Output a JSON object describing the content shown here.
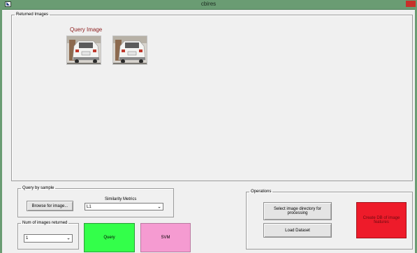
{
  "window": {
    "title": "cbires",
    "app_icon": "matlab-figure-icon",
    "close_color": "#c8302a"
  },
  "returned_images": {
    "legend": "Returned Images",
    "query_label": "Query Image",
    "thumbnails": [
      "car-photo-thumbnail",
      "car-photo-thumbnail"
    ]
  },
  "query_by_sample": {
    "legend": "Query by sample",
    "browse_label": "Browse for image...",
    "metrics_label": "Similarity Metrics",
    "metrics_value": "L1"
  },
  "num_images": {
    "legend": "Num of images returned",
    "value": "1"
  },
  "buttons": {
    "query": {
      "label": "Query",
      "color": "#33ff4a"
    },
    "svm": {
      "label": "SVM",
      "color": "#f59bd1"
    }
  },
  "operations": {
    "legend": "Operations",
    "select_dir_label": "Select image directory for processing",
    "load_dataset_label": "Load Dataset",
    "create_db_label": "Create DB of image features",
    "create_db_color": "#ee1b2a"
  }
}
